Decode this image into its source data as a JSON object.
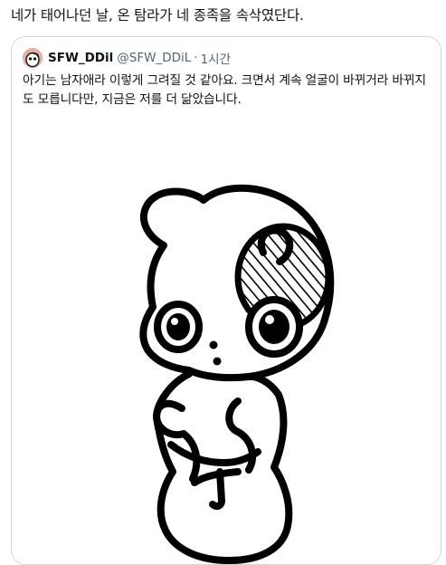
{
  "post": {
    "text": "네가 태어나던 날, 온 탐라가 네 종족을 속삭였단다."
  },
  "quote": {
    "display_name": "SFW_DDil",
    "handle": "@SFW_DDiL",
    "separator": "·",
    "time": "1시간",
    "text": "아기는 남자애라 이렇게 그려질 것 같아요. 크면서 계속 얼굴이 바뀌거라 바뀌지도 모릅니다만, 지금은 저를 더 닮았습니다.",
    "avatar_icon": "cartoon-creature-avatar",
    "media_description_icon": "doodle-creature-drawing"
  }
}
